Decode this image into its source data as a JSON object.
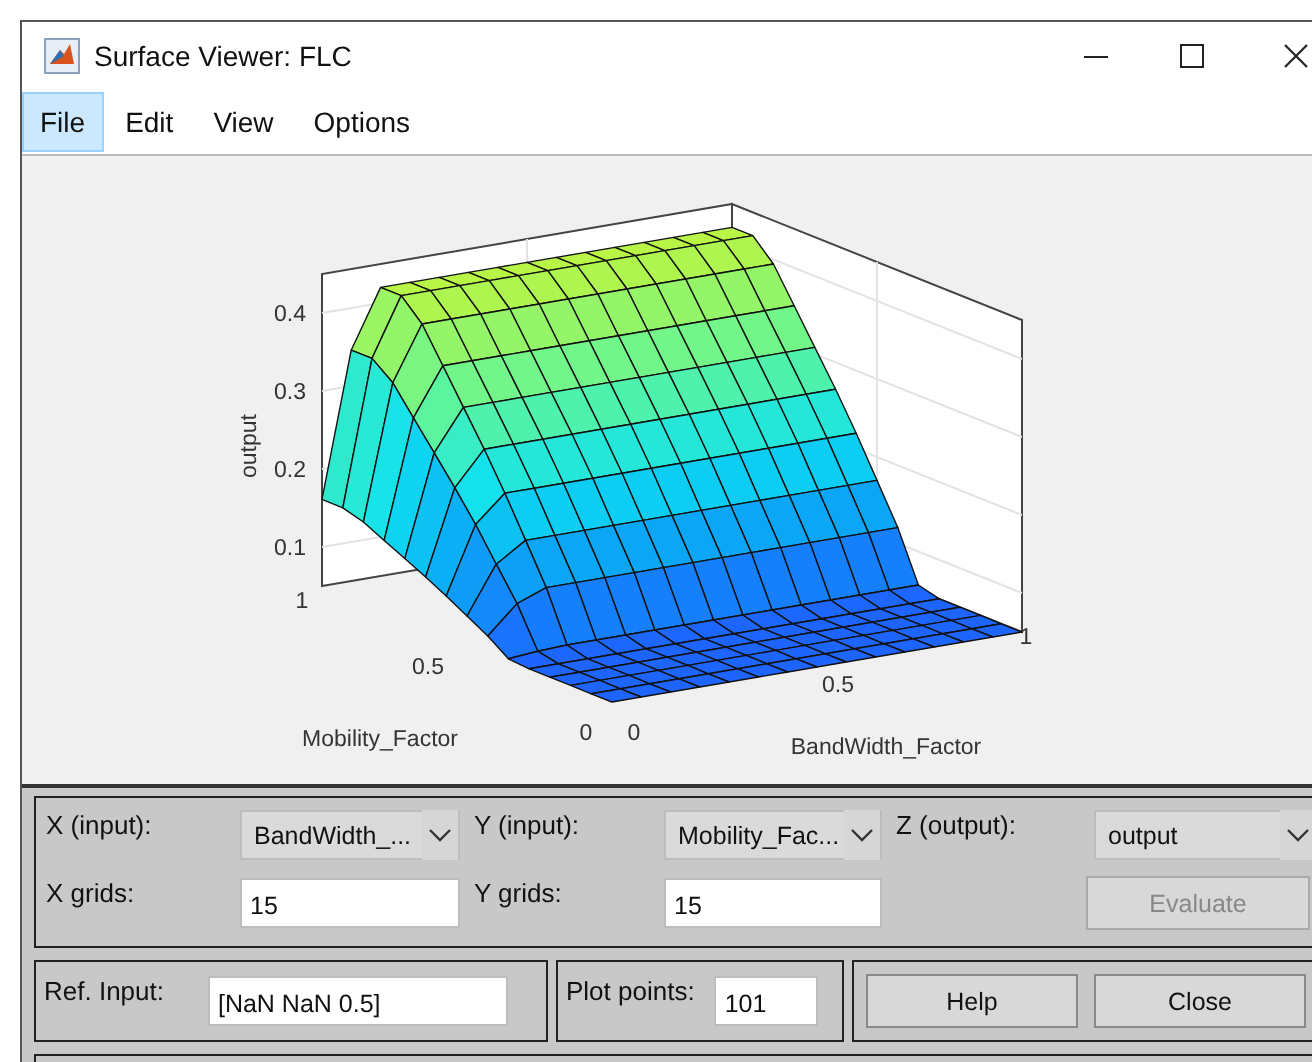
{
  "window": {
    "title": "Surface Viewer: FLC"
  },
  "menu": [
    {
      "label": "File",
      "selected": true
    },
    {
      "label": "Edit",
      "selected": false
    },
    {
      "label": "View",
      "selected": false
    },
    {
      "label": "Options",
      "selected": false
    }
  ],
  "plot": {
    "z_label": "output",
    "x_label": "BandWidth_Factor",
    "y_label": "Mobility_Factor",
    "z_ticks": [
      "0.4",
      "0.3",
      "0.2",
      "0.1"
    ],
    "y_ticks": [
      "1",
      "0.5",
      "0"
    ],
    "x_ticks": [
      "0",
      "0.5",
      "1"
    ]
  },
  "axes_row": [
    {
      "label": "X (input):",
      "value": "BandWidth_..."
    },
    {
      "label": "Y (input):",
      "value": "Mobility_Fac..."
    },
    {
      "label": "Z (output):",
      "value": "output"
    }
  ],
  "grids_row": [
    {
      "label": "X grids:",
      "value": "15"
    },
    {
      "label": "Y grids:",
      "value": "15"
    }
  ],
  "evaluate": {
    "label": "Evaluate",
    "disabled": true
  },
  "ref_input": {
    "label": "Ref. Input:",
    "value": "[NaN NaN 0.5]"
  },
  "plot_points": {
    "label": "Plot points:",
    "value": "101"
  },
  "buttons": [
    "Help",
    "Close"
  ]
}
